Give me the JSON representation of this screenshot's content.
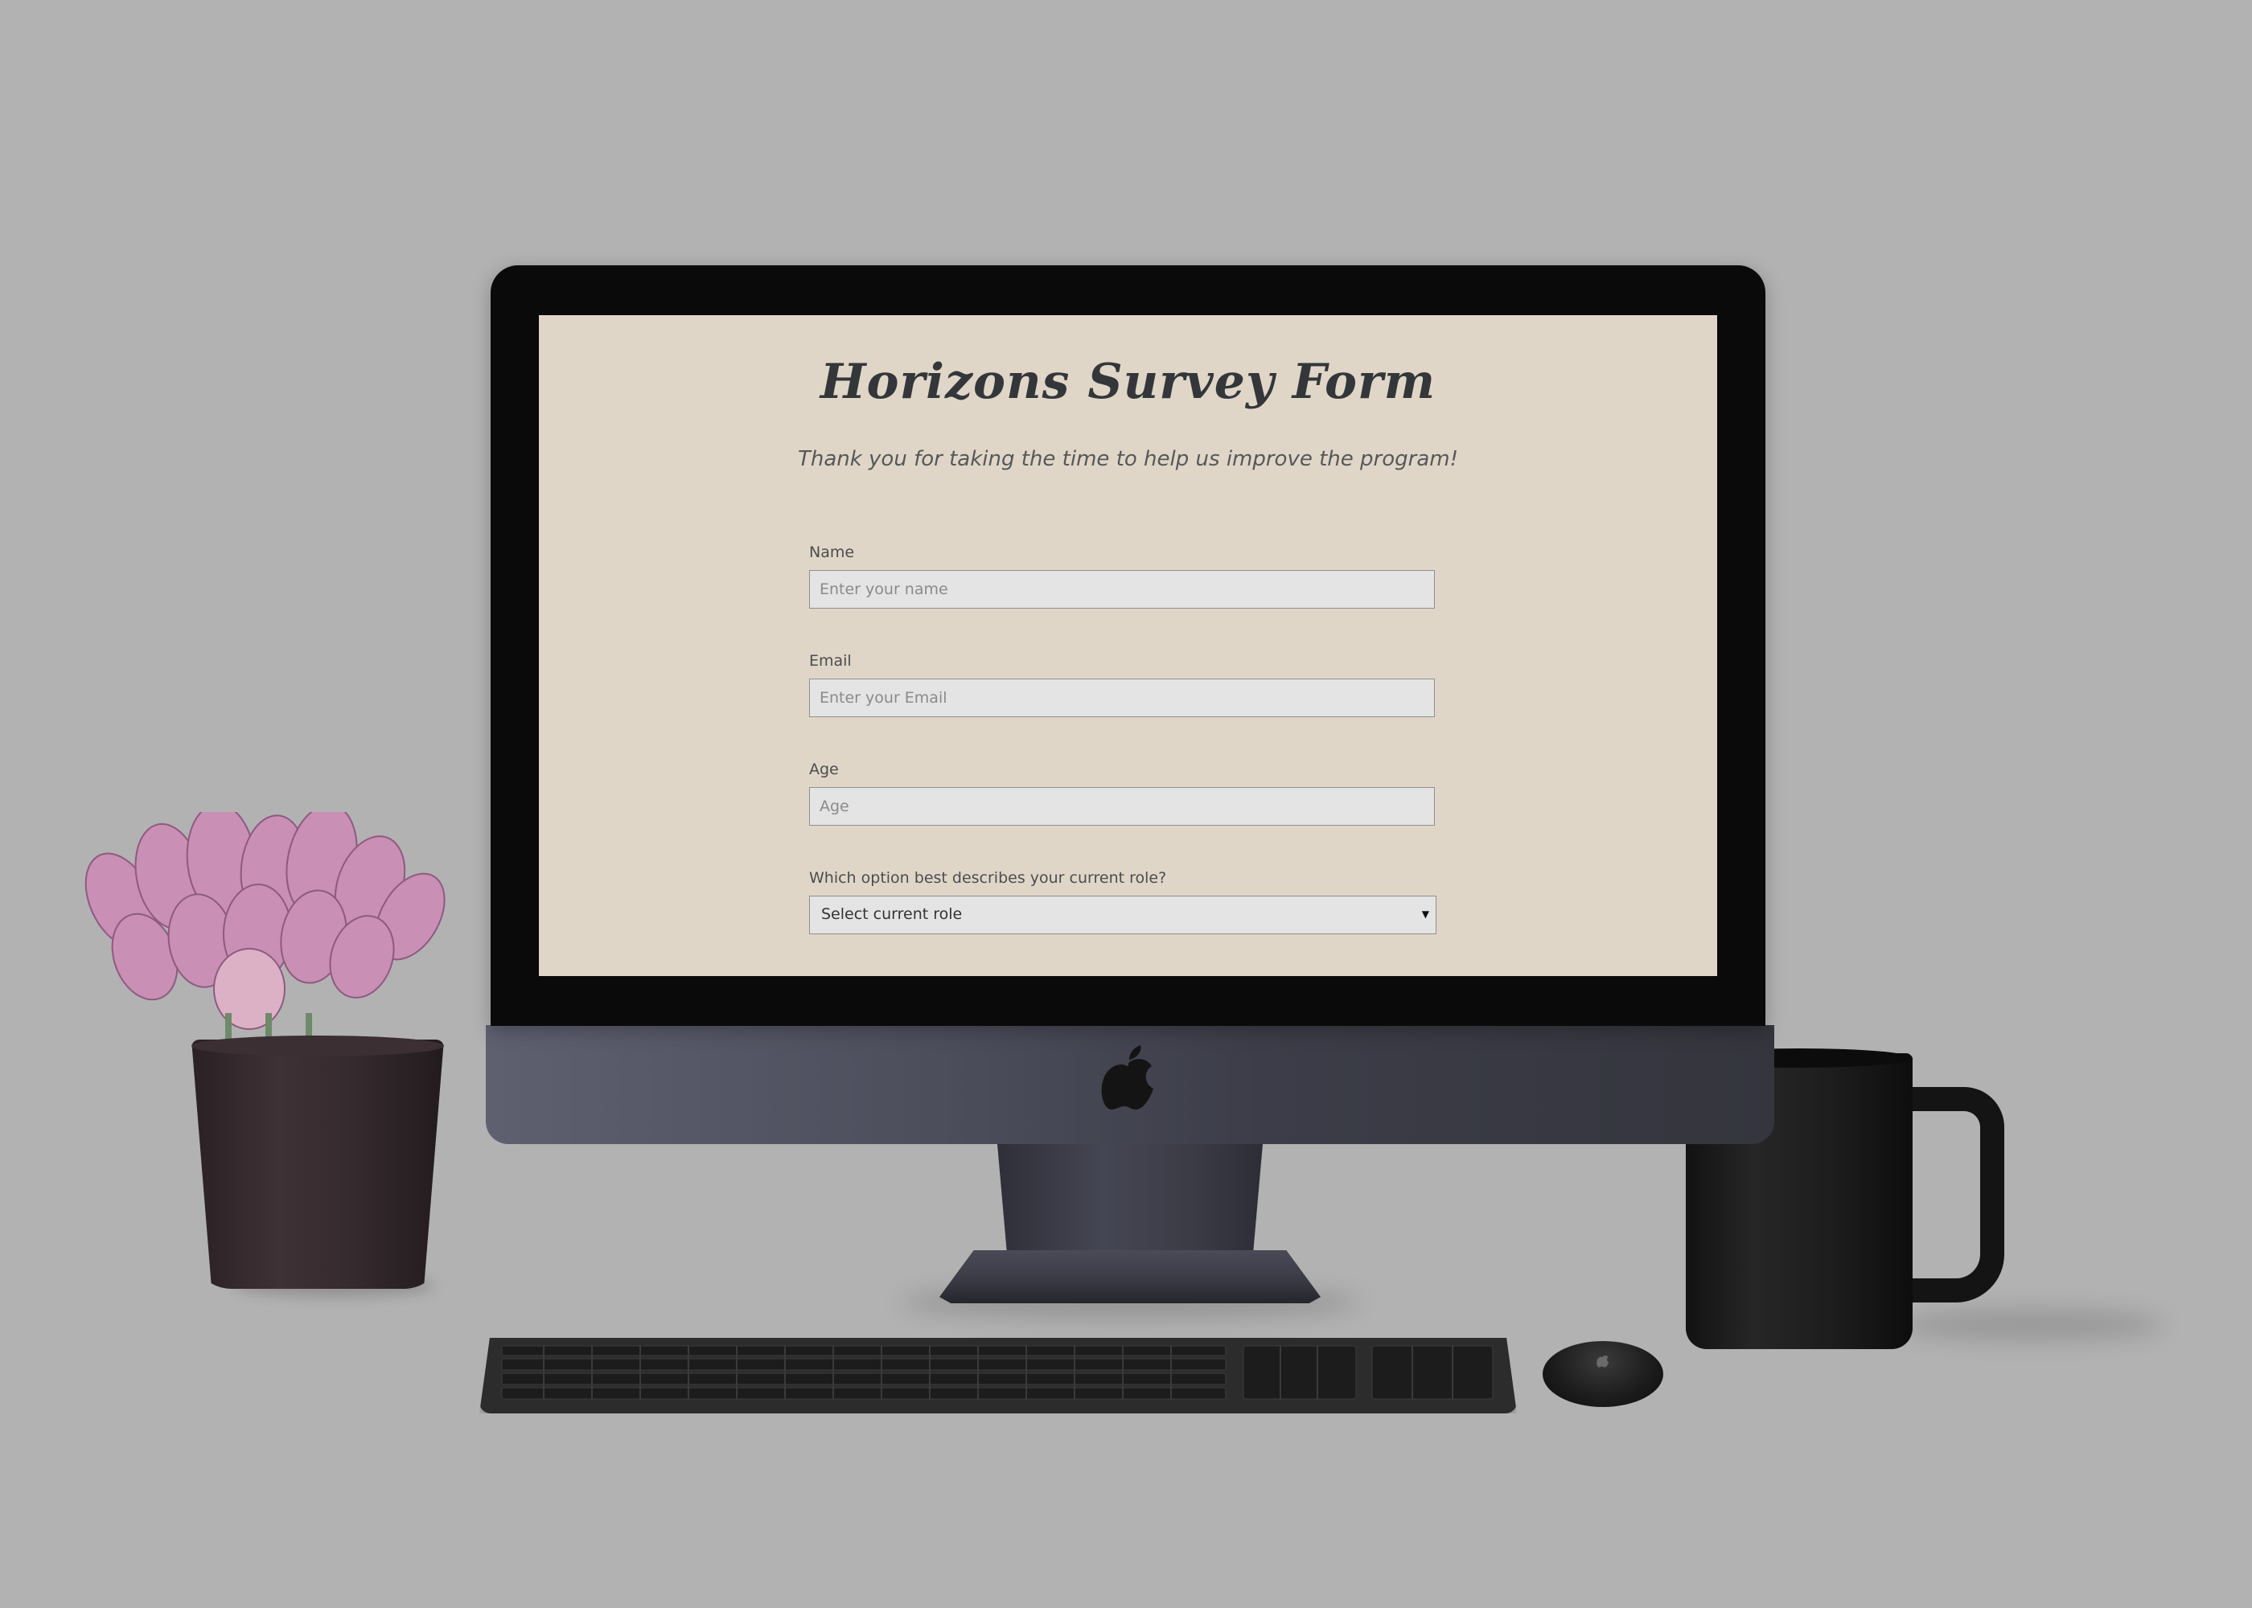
{
  "form": {
    "title": "Horizons Survey Form",
    "subtitle": "Thank you for taking the time to help us improve the program!",
    "fields": [
      {
        "label": "Name",
        "placeholder": "Enter your name"
      },
      {
        "label": "Email",
        "placeholder": "Enter your Email"
      },
      {
        "label": "Age",
        "placeholder": "Age"
      }
    ],
    "role": {
      "label": "Which option best describes your current role?",
      "selected": "Select current role"
    }
  },
  "icons": {
    "monitor_logo": "apple-logo-icon",
    "select_caret": "caret-down-icon"
  },
  "colors": {
    "screen_background": "#e0d6c8",
    "title_text": "#33373a",
    "backdrop": "#b2b2b2"
  }
}
